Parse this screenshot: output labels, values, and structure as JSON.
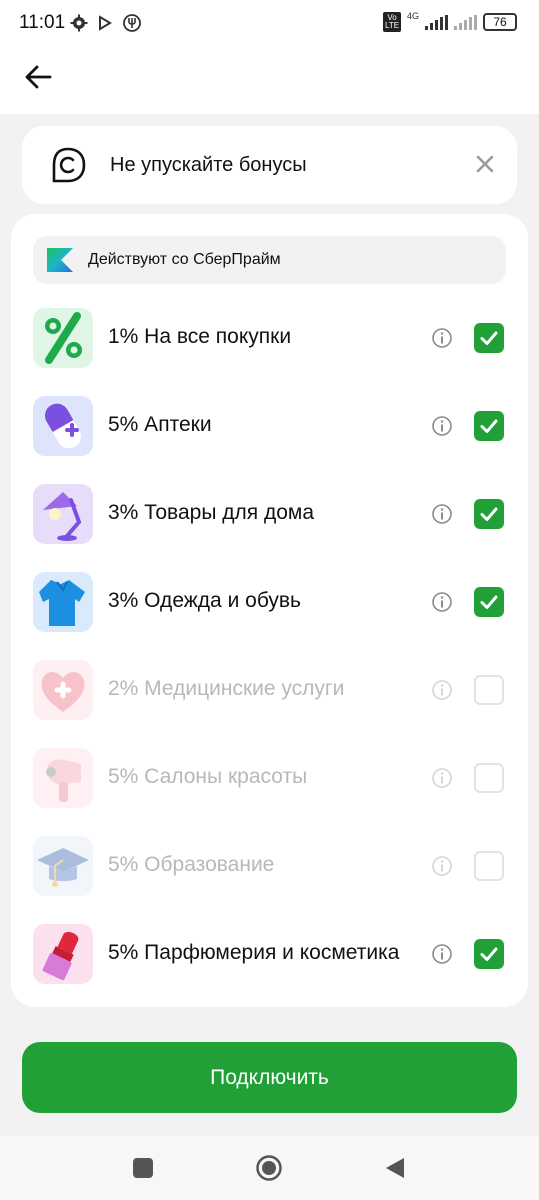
{
  "status_bar": {
    "time": "11:01",
    "network_type": "4G",
    "volte_label": "Vo LTE",
    "battery": "76"
  },
  "banner": {
    "text": "Не упускайте бонусы"
  },
  "prime": {
    "label": "Действуют со СберПрайм"
  },
  "categories": [
    {
      "label": "1% На все покупки",
      "checked": true,
      "enabled": true,
      "icon": "percent-icon"
    },
    {
      "label": "5% Аптеки",
      "checked": true,
      "enabled": true,
      "icon": "pill-icon"
    },
    {
      "label": "3% Товары для дома",
      "checked": true,
      "enabled": true,
      "icon": "lamp-icon"
    },
    {
      "label": "3% Одежда и обувь",
      "checked": true,
      "enabled": true,
      "icon": "shirt-icon"
    },
    {
      "label": "2% Медицинские услуги",
      "checked": false,
      "enabled": false,
      "icon": "medical-heart-icon"
    },
    {
      "label": "5% Салоны красоты",
      "checked": false,
      "enabled": false,
      "icon": "hair-dryer-icon"
    },
    {
      "label": "5% Образование",
      "checked": false,
      "enabled": false,
      "icon": "graduation-cap-icon"
    },
    {
      "label": "5% Парфюмерия и косметика",
      "checked": true,
      "enabled": true,
      "icon": "lipstick-icon"
    }
  ],
  "actions": {
    "connect_label": "Подключить"
  },
  "colors": {
    "accent": "#21a038",
    "background": "#f2f2f2"
  }
}
